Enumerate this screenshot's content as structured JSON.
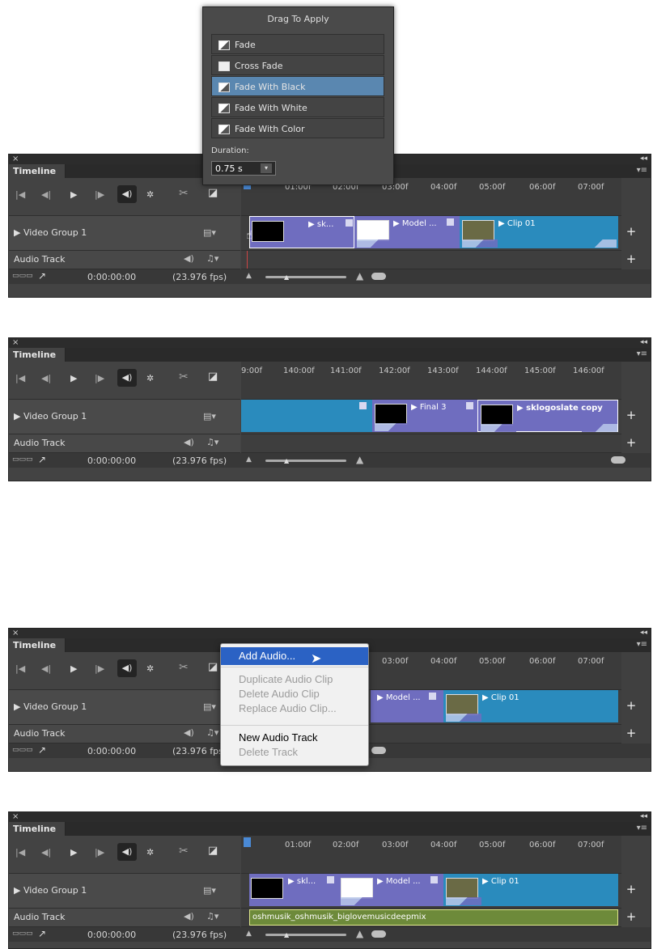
{
  "panel": {
    "close": "×",
    "collapse": "◂◂",
    "tab": "Timeline",
    "menu": "▾≡",
    "video_group": "▶  Video Group 1",
    "audio_track": "Audio Track",
    "timecode": "0:00:00:00",
    "fps": "(23.976 fps)",
    "plus": "+",
    "status_icon": "▭▭▭",
    "render_icon": "↗"
  },
  "controls": {
    "first": "|◀",
    "prev": "◀|",
    "play": "▶",
    "next": "|▶",
    "speaker": "◀)",
    "gear": "✲",
    "scissors": "✂",
    "transition": "◪",
    "film": "▤▾",
    "speaker_small": "◀)",
    "note": "♫▾"
  },
  "ruler1": [
    "01:00f",
    "02:00f",
    "03:00f",
    "04:00f",
    "05:00f",
    "06:00f",
    "07:00f"
  ],
  "ruler2": [
    "9:00f",
    "140:00f",
    "141:00f",
    "142:00f",
    "143:00f",
    "144:00f",
    "145:00f",
    "146:00f"
  ],
  "ruler3": [
    "03:00f",
    "04:00f",
    "05:00f",
    "06:00f",
    "07:00f"
  ],
  "ruler4": [
    "01:00f",
    "02:00f",
    "03:00f",
    "04:00f",
    "05:00f",
    "06:00f",
    "07:00f"
  ],
  "clips1": {
    "a": "▶ sk...",
    "b": "▶ Model ...",
    "c": "▶ Clip 01"
  },
  "clips2": {
    "a": "▶ Final 3",
    "b": "▶ sklogoslate copy"
  },
  "clips3": {
    "b": "▶ Model ...",
    "c": "▶ Clip 01"
  },
  "clips4": {
    "a": "▶ skl...",
    "b": "▶ Model ...",
    "c": "▶ Clip 01",
    "audio": "oshmusik_oshmusik_biglovemusicdeepmix"
  },
  "dialog": {
    "title": "Drag To Apply",
    "items": [
      "Fade",
      "Cross Fade",
      "Fade With Black",
      "Fade With White",
      "Fade With Color"
    ],
    "duration_label": "Duration:",
    "duration_value": "0.75 s"
  },
  "context_menu": {
    "add_audio": "Add Audio...",
    "duplicate": "Duplicate Audio Clip",
    "delete_clip": "Delete Audio Clip",
    "replace": "Replace Audio Clip...",
    "new_track": "New Audio Track",
    "delete_track": "Delete Track"
  },
  "colors": {
    "clip_purple": "#6f6dbf",
    "clip_teal": "#2a8bbd",
    "audio_clip": "#6d8a3a",
    "selected": "#5a87b0",
    "menu_highlight": "#2b62c4"
  }
}
